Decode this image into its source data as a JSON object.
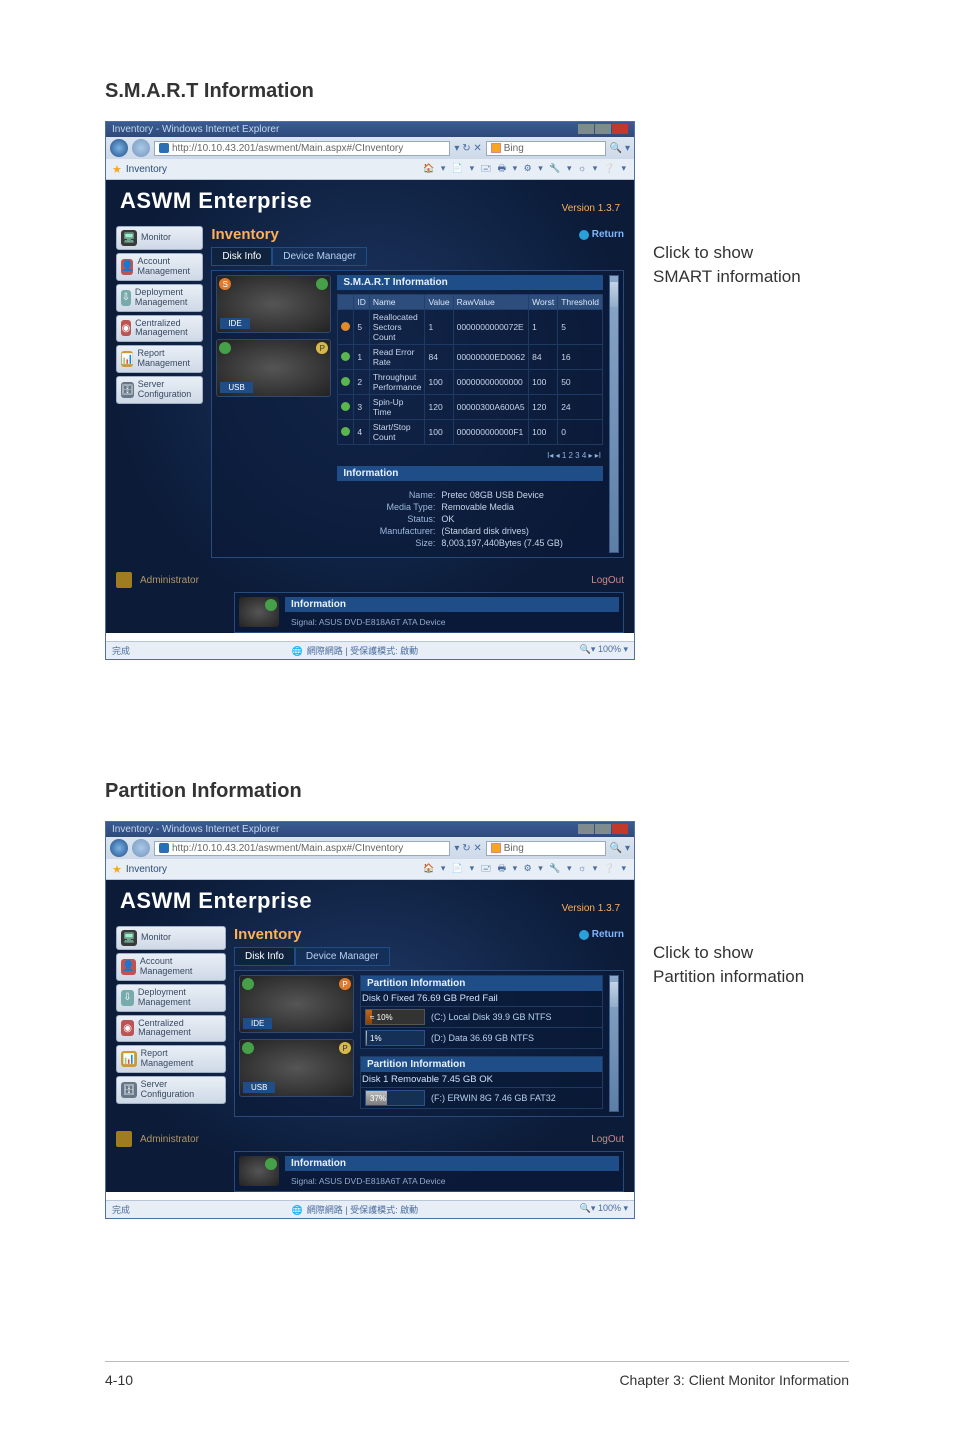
{
  "heading1": "S.M.A.R.T Information",
  "heading2": "Partition Information",
  "caption1_line1": "Click to show",
  "caption1_line2": "SMART information",
  "caption2_line1": "Click to show",
  "caption2_line2": "Partition information",
  "browser": {
    "title": "Inventory - Windows Internet Explorer",
    "address": "http://10.10.43.201/aswment/Main.aspx#/CInventory",
    "search_placeholder": "Bing",
    "tab_label": "Inventory",
    "status_text": "網際網路 | 受保護模式: 啟動",
    "zoom": "100%"
  },
  "app": {
    "title": "ASWM Enterprise",
    "version": "Version 1.3.7",
    "page_title": "Inventory",
    "return_label": "Return",
    "admin": "Administrator",
    "logout": "LogOut",
    "done": "完成"
  },
  "sidebar": {
    "items": [
      {
        "label": "Monitor"
      },
      {
        "label": "Account Management"
      },
      {
        "label": "Deployment Management"
      },
      {
        "label": "Centralized Management"
      },
      {
        "label": "Report Management"
      },
      {
        "label": "Server Configuration"
      }
    ]
  },
  "subtabs": {
    "a": "Disk Info",
    "b": "Device Manager"
  },
  "smart_panel": {
    "title": "S.M.A.R.T Information",
    "info_title": "Information",
    "drives": {
      "ide": "IDE",
      "usb": "USB"
    },
    "badges": {
      "s": "S",
      "p": "P"
    },
    "columns": {
      "id": "ID",
      "name": "Name",
      "value": "Value",
      "raw": "RawValue",
      "worst": "Worst",
      "threshold": "Threshold"
    },
    "rows": [
      {
        "id": "5",
        "name": "Reallocated Sectors Count",
        "value": "1",
        "raw": "0000000000072E",
        "worst": "1",
        "thr": "5",
        "dot": "o"
      },
      {
        "id": "1",
        "name": "Read Error Rate",
        "value": "84",
        "raw": "00000000ED0062",
        "worst": "84",
        "thr": "16",
        "dot": "g"
      },
      {
        "id": "2",
        "name": "Throughput Performance",
        "value": "100",
        "raw": "00000000000000",
        "worst": "100",
        "thr": "50",
        "dot": "g"
      },
      {
        "id": "3",
        "name": "Spin-Up Time",
        "value": "120",
        "raw": "00000300A600A5",
        "worst": "120",
        "thr": "24",
        "dot": "g"
      },
      {
        "id": "4",
        "name": "Start/Stop Count",
        "value": "100",
        "raw": "000000000000F1",
        "worst": "100",
        "thr": "0",
        "dot": "g"
      }
    ],
    "pager": "I◂ ◂ 1 2 3 4 ▸ ▸I",
    "info": {
      "name_lab": "Name:",
      "name": "Pretec 08GB USB Device",
      "media_lab": "Media Type:",
      "media": "Removable Media",
      "status_lab": "Status:",
      "status": "OK",
      "manu_lab": "Manufacturer:",
      "manu": "(Standard disk drives)",
      "size_lab": "Size:",
      "size": "8,003,197,440Bytes (7.45 GB)"
    },
    "info2_title": "Information",
    "info2_sub": "Signal: ASUS DVD-E818A6T ATA Device"
  },
  "partition_panel": {
    "title": "Partition Information",
    "title2": "Partition Information",
    "info_title": "Information",
    "disk0": {
      "line": "Disk 0 Fixed  76.69 GB  Pred Fail",
      "total_pct": "≈ 10%",
      "total_label": "(C:) Local Disk  39.9 GB  NTFS",
      "p1_pct": "1%",
      "p1_label": "(D:) Data  36.69 GB  NTFS"
    },
    "disk1": {
      "line": "Disk 1 Removable  7.45 GB  OK",
      "p1_pct": "37%",
      "p1_label": "(F:) ERWIN 8G  7.46 GB  FAT32"
    },
    "info2_sub": "Signal: ASUS DVD-E818A6T ATA Device"
  },
  "footer": {
    "left": "4-10",
    "right": "Chapter 3: Client Monitor Information"
  }
}
